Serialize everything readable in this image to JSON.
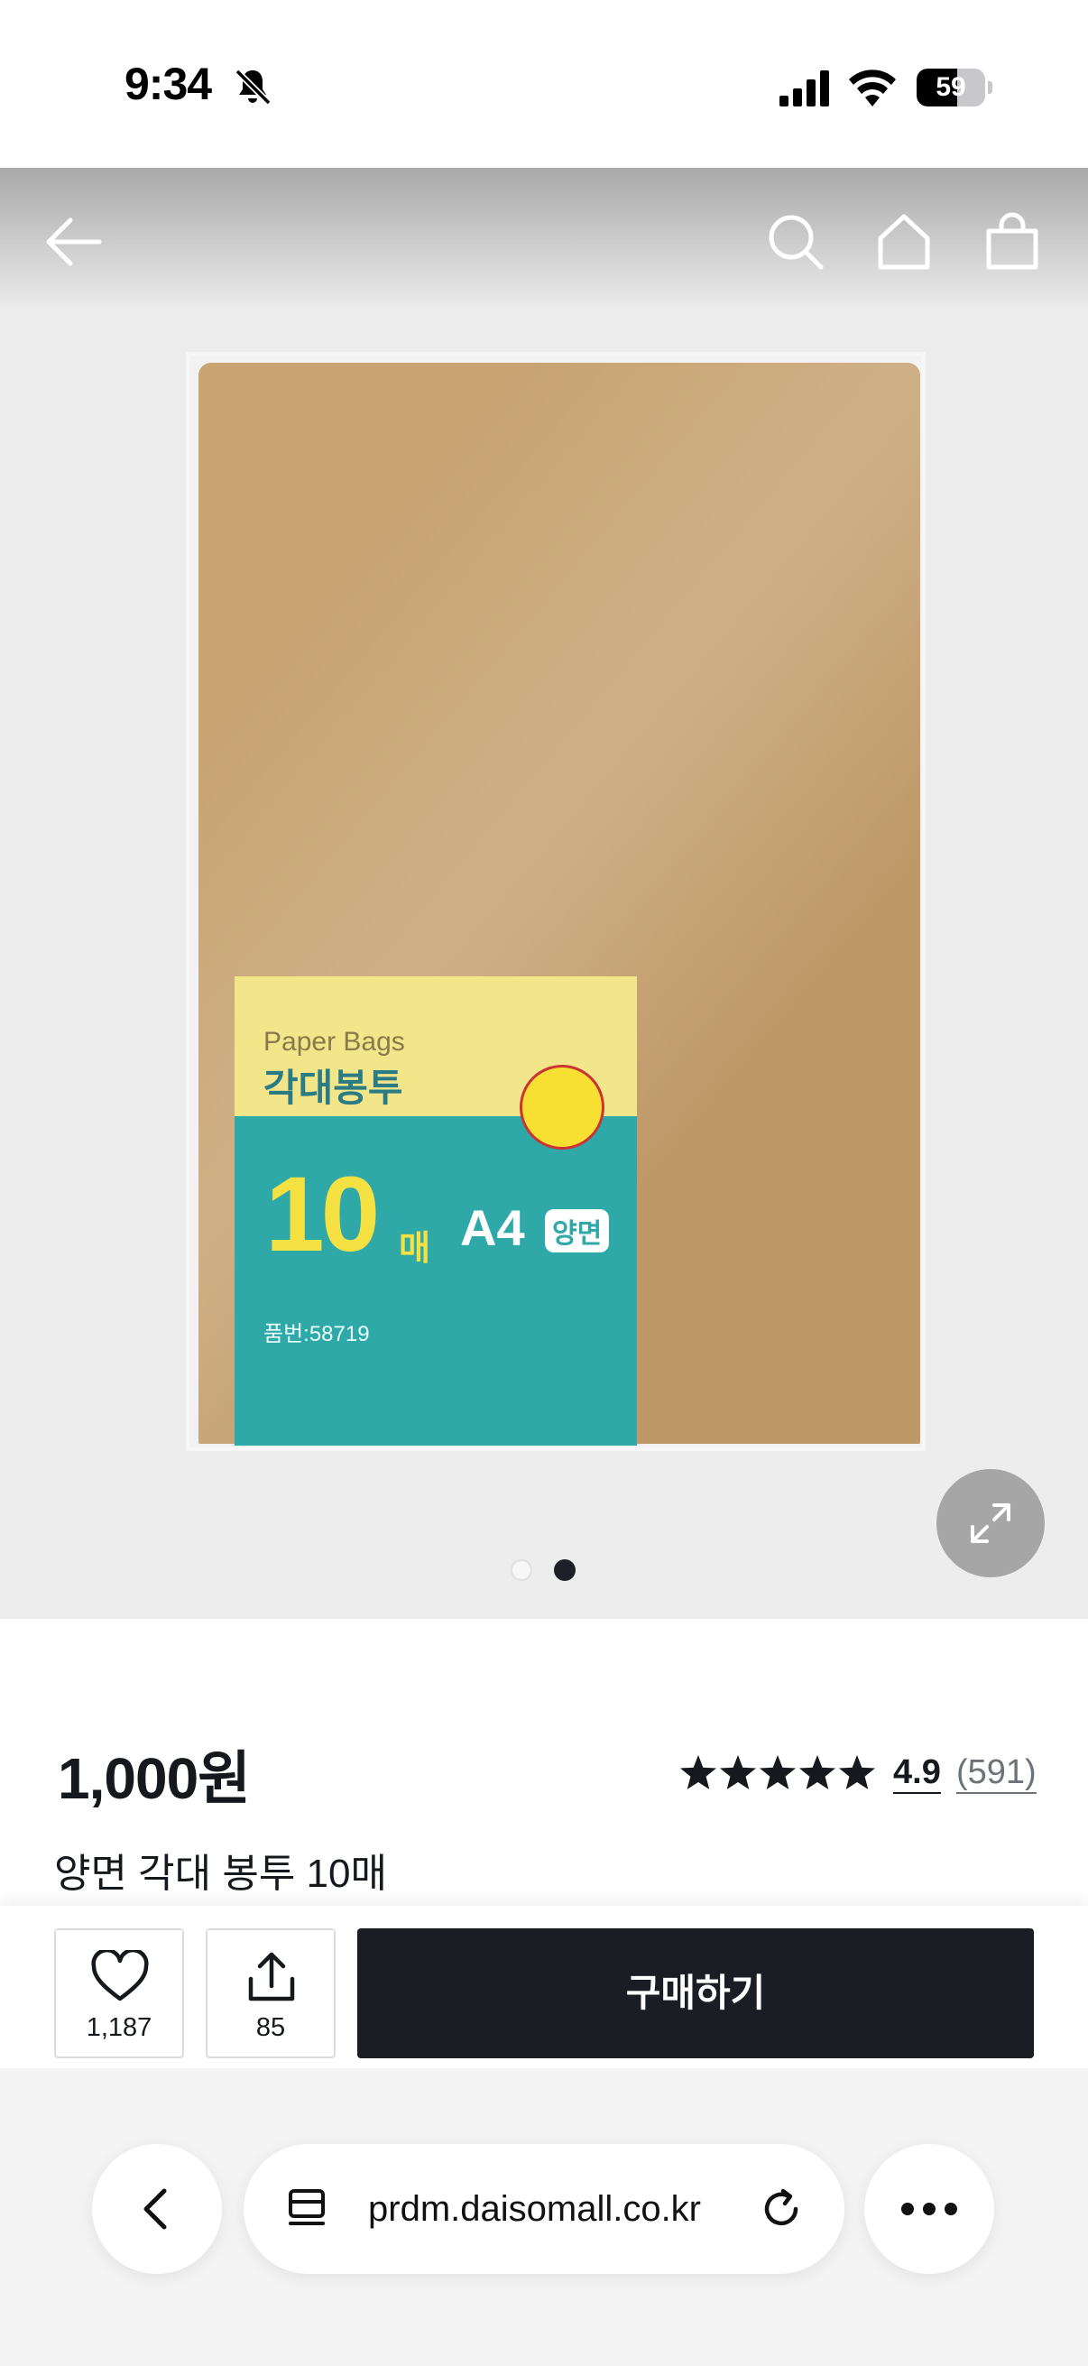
{
  "status_bar": {
    "time": "9:34",
    "battery_level": "59",
    "battery_fraction": 0.59
  },
  "top_nav": {
    "icons": [
      "back-arrow-icon",
      "search-icon",
      "home-icon",
      "shopping-bag-icon"
    ]
  },
  "gallery": {
    "current_slide": 2,
    "total_slides": 2,
    "package_label": {
      "english_name": "Paper Bags",
      "korean_name": "각대봉투",
      "quantity": "10",
      "quantity_unit": "매",
      "size": "A4",
      "type": "양면",
      "product_code": "품번:58719"
    }
  },
  "product": {
    "price": "1,000원",
    "rating_stars": 5,
    "rating_score": "4.9",
    "review_count": "(591)",
    "name": "양면 각대 봉투 10매"
  },
  "actions": {
    "like_count": "1,187",
    "share_count": "85",
    "buy_label": "구매하기"
  },
  "browser": {
    "url": "prdm.daisomall.co.kr"
  },
  "colors": {
    "buy_button": "#1a1e24",
    "envelope": "#c59f6c",
    "label_teal": "#2fa8a8"
  }
}
